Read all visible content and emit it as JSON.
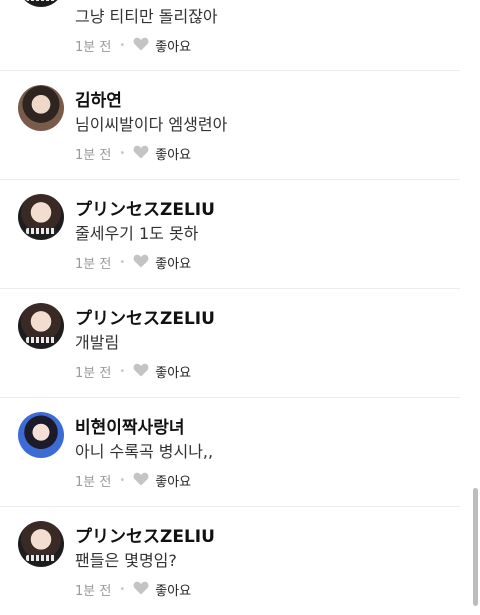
{
  "comments": [
    {
      "username": "",
      "text": "그냥 티티만 돌리잖아",
      "time": "1분 전",
      "like_label": "좋아요",
      "avatar_icon": "profile-avatar"
    },
    {
      "username": "김하연",
      "text": "님이씨발이다 엠생련아",
      "time": "1분 전",
      "like_label": "좋아요",
      "avatar_icon": "profile-avatar"
    },
    {
      "username": "プリンセスZELIU",
      "text": "줄세우기 1도 못하",
      "time": "1분 전",
      "like_label": "좋아요",
      "avatar_icon": "profile-avatar"
    },
    {
      "username": "プリンセスZELIU",
      "text": "개발림",
      "time": "1분 전",
      "like_label": "좋아요",
      "avatar_icon": "profile-avatar"
    },
    {
      "username": "비현이짝사랑녀",
      "text": "아니 수록곡 병시나,,",
      "time": "1분 전",
      "like_label": "좋아요",
      "avatar_icon": "profile-avatar"
    },
    {
      "username": "プリンセスZELIU",
      "text": "팬들은 몇명임?",
      "time": "1분 전",
      "like_label": "좋아요",
      "avatar_icon": "profile-avatar"
    }
  ],
  "colors": {
    "heart": "#c4c4c4",
    "meta": "#9a9a9a",
    "divider": "#ececec"
  }
}
